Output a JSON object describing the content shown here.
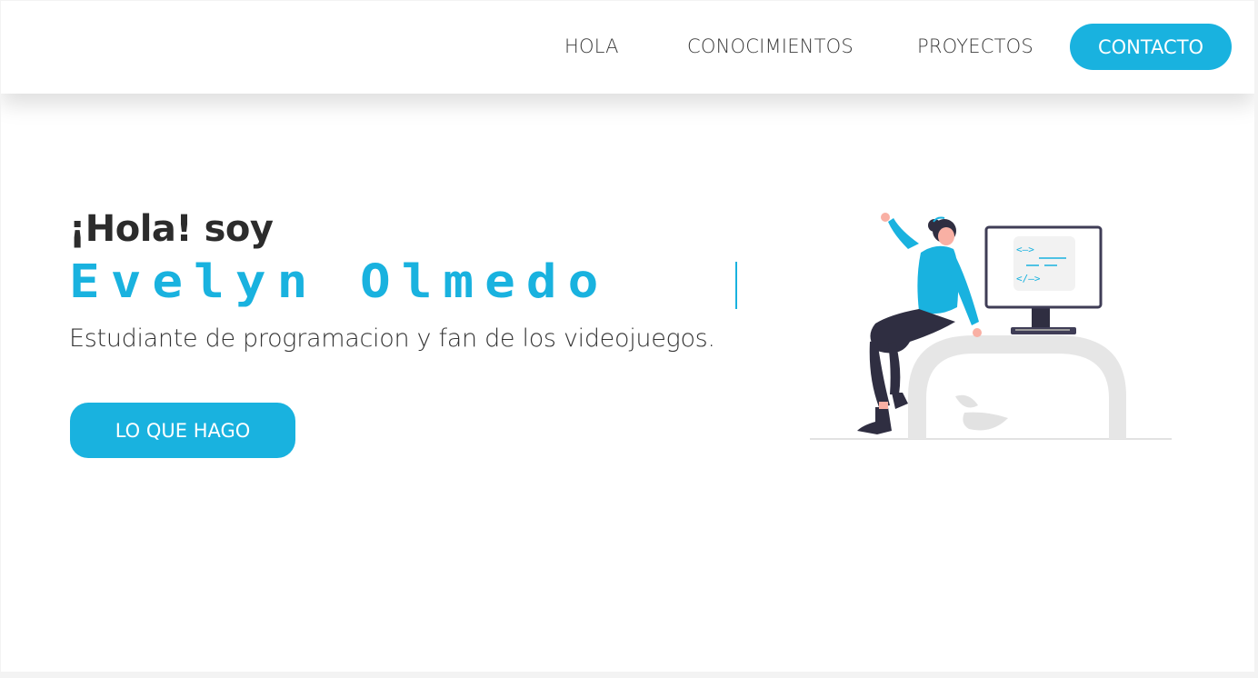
{
  "nav": {
    "links": [
      "HOLA",
      "CONOCIMIENTOS",
      "PROYECTOS"
    ],
    "cta": "CONTACTO"
  },
  "hero": {
    "greeting": "¡Hola! soy",
    "name": "Evelyn Olmedo",
    "subtitle": "Estudiante de programacion y fan de los videojuegos.",
    "cta": "LO QUE HAGO"
  },
  "illustration": {
    "monitor_code_lines": [
      "<—>",
      "</—>"
    ]
  },
  "colors": {
    "accent": "#19b2df",
    "text": "#2c2c2c",
    "background": "#ffffff"
  }
}
